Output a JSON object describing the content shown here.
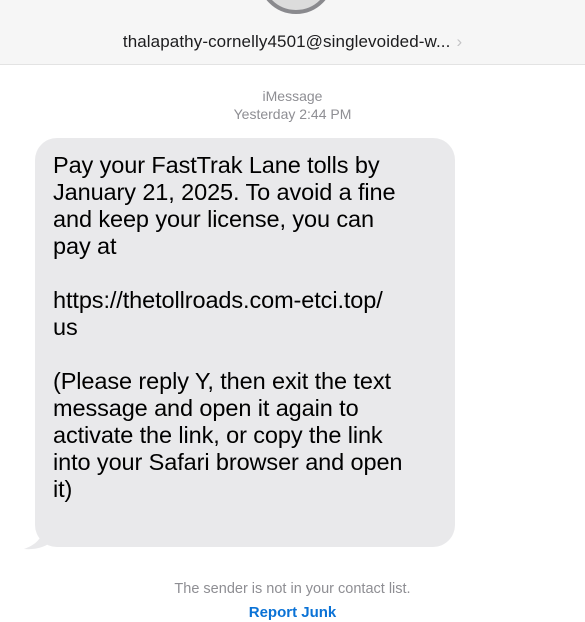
{
  "header": {
    "sender_address": "thalapathy-cornelly4501@singlevoided-w...",
    "chevron": "›"
  },
  "conversation": {
    "service": "iMessage",
    "timestamp_day": "Yesterday",
    "timestamp_time": "2:44 PM",
    "message": {
      "paragraphs": [
        "Pay your FastTrak Lane tolls by\nJanuary 21, 2025. To avoid a fine\nand keep your license, you can\npay at",
        "https://thetollroads.com-etci.top/\nus",
        "(Please reply Y, then exit the text\nmessage and open it again to\nactivate the link, or copy the link\ninto your Safari browser and open\nit)"
      ]
    }
  },
  "footer": {
    "unknown_sender_notice": "The sender is not in your contact list.",
    "report_junk_label": "Report Junk"
  },
  "colors": {
    "bubble": "#e9e9eb",
    "link_blue": "#0a72d6",
    "meta_gray": "#8e8e93"
  },
  "icons": {
    "avatar": "contact-avatar-icon",
    "chevron": "chevron-right-icon"
  }
}
